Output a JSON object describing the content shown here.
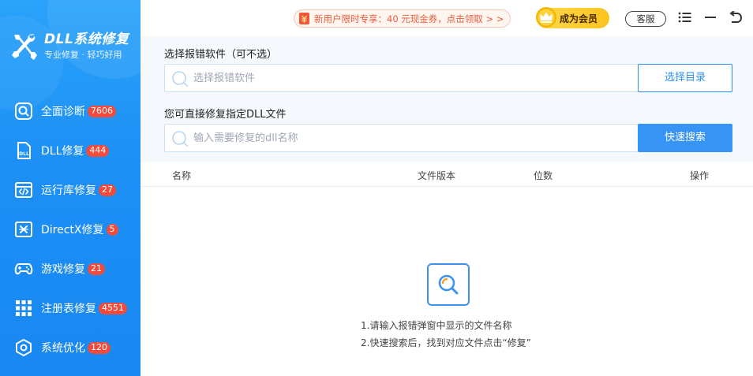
{
  "brand": {
    "title": "DLL系统修复",
    "subtitle": "专业修复 · 轻巧好用"
  },
  "nav": {
    "items": [
      {
        "label": "全面诊断",
        "badge": "7606",
        "icon": "search-scan-icon"
      },
      {
        "label": "DLL修复",
        "badge": "444",
        "icon": "dll-file-icon"
      },
      {
        "label": "运行库修复",
        "badge": "27",
        "icon": "code-window-icon"
      },
      {
        "label": "DirectX修复",
        "badge": "5",
        "icon": "directx-icon"
      },
      {
        "label": "游戏修复",
        "badge": "21",
        "icon": "gamepad-icon"
      },
      {
        "label": "注册表修复",
        "badge": "4551",
        "icon": "grid-dots-icon"
      },
      {
        "label": "系统优化",
        "badge": "120",
        "icon": "hexagon-gear-icon"
      }
    ]
  },
  "topbar": {
    "promo": "新用户限时专享：40 元现金券，点击领取 > >",
    "vip": "成为会员",
    "service": "客服"
  },
  "search": {
    "software_label": "选择报错软件（可不选）",
    "software_placeholder": "选择报错软件",
    "dir_button": "选择目录",
    "dll_label": "您可直接修复指定DLL文件",
    "dll_placeholder": "输入需要修复的dll名称",
    "search_button": "快速搜索"
  },
  "table": {
    "columns": [
      "名称",
      "文件版本",
      "位数",
      "操作"
    ]
  },
  "empty": {
    "line1": "1.请输入报错弹窗中显示的文件名称",
    "line2": "2.快速搜索后，找到对应文件点击“修复”"
  },
  "colors": {
    "sidebar": "#1c8ff5",
    "accent": "#3794f4",
    "badge": "#f24b3c",
    "promo_text": "#ea5a3b",
    "vip": "#fbc41e"
  }
}
